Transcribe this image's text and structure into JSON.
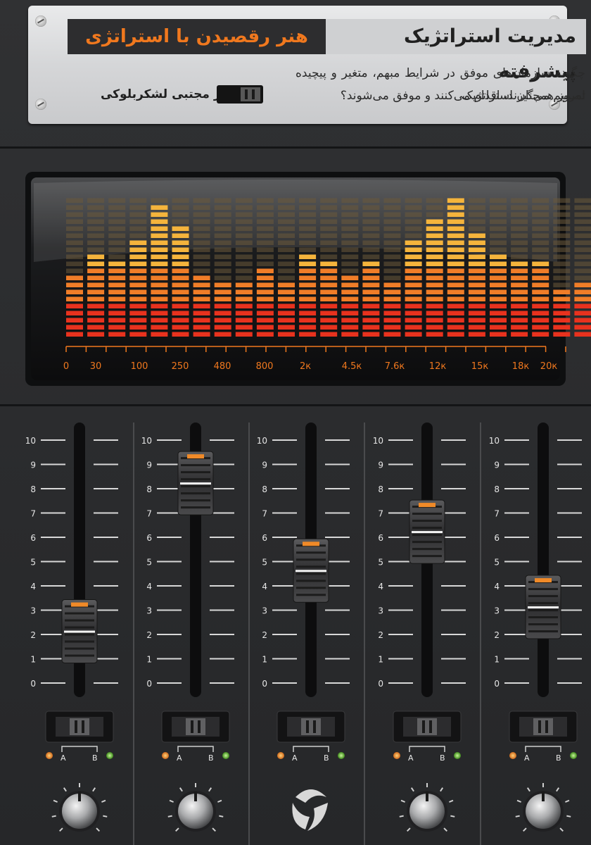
{
  "plate": {
    "main_title": "مدیریت استراتژیک پیشرفته",
    "sub_title": "هنر رقصیدن با استراتژی",
    "description_line_1": "چگونه سازمان‌های موفق در شرایط مبهم، متغیر و پیچیده امروز همچنان استراتژیک",
    "description_line_2": "تصمیم می‌گیرند، اقدام می‌کنند و موفق می‌شوند؟",
    "author": "دکتر مجتبی لشکربلوکی"
  },
  "equalizer": {
    "freq_labels": [
      "0",
      "30",
      "100",
      "250",
      "480",
      "800",
      "2к",
      "4.5к",
      "7.6к",
      "12к",
      "15к",
      "18к",
      "20к"
    ],
    "band_levels": [
      9,
      12,
      11,
      14,
      19,
      16,
      9,
      8,
      8,
      10,
      8,
      12,
      11,
      9,
      11,
      8,
      14,
      17,
      20,
      15,
      12,
      11,
      11,
      7,
      8
    ],
    "colors": {
      "low": "#e8321e",
      "mid": "#f07d28",
      "high": "#f5b43c",
      "unlit": "#6b5a3a",
      "label": "#f0781e"
    }
  },
  "faders": {
    "scale": [
      "10",
      "9",
      "8",
      "7",
      "6",
      "5",
      "4",
      "3",
      "2",
      "1",
      "0"
    ],
    "channels": [
      {
        "level": 2.1,
        "switch_a": "A",
        "switch_b": "B"
      },
      {
        "level": 8.2,
        "switch_a": "A",
        "switch_b": "B"
      },
      {
        "level": 4.6,
        "switch_a": "A",
        "switch_b": "B"
      },
      {
        "level": 6.2,
        "switch_a": "A",
        "switch_b": "B"
      },
      {
        "level": 3.1,
        "switch_a": "A",
        "switch_b": "B"
      }
    ]
  }
}
